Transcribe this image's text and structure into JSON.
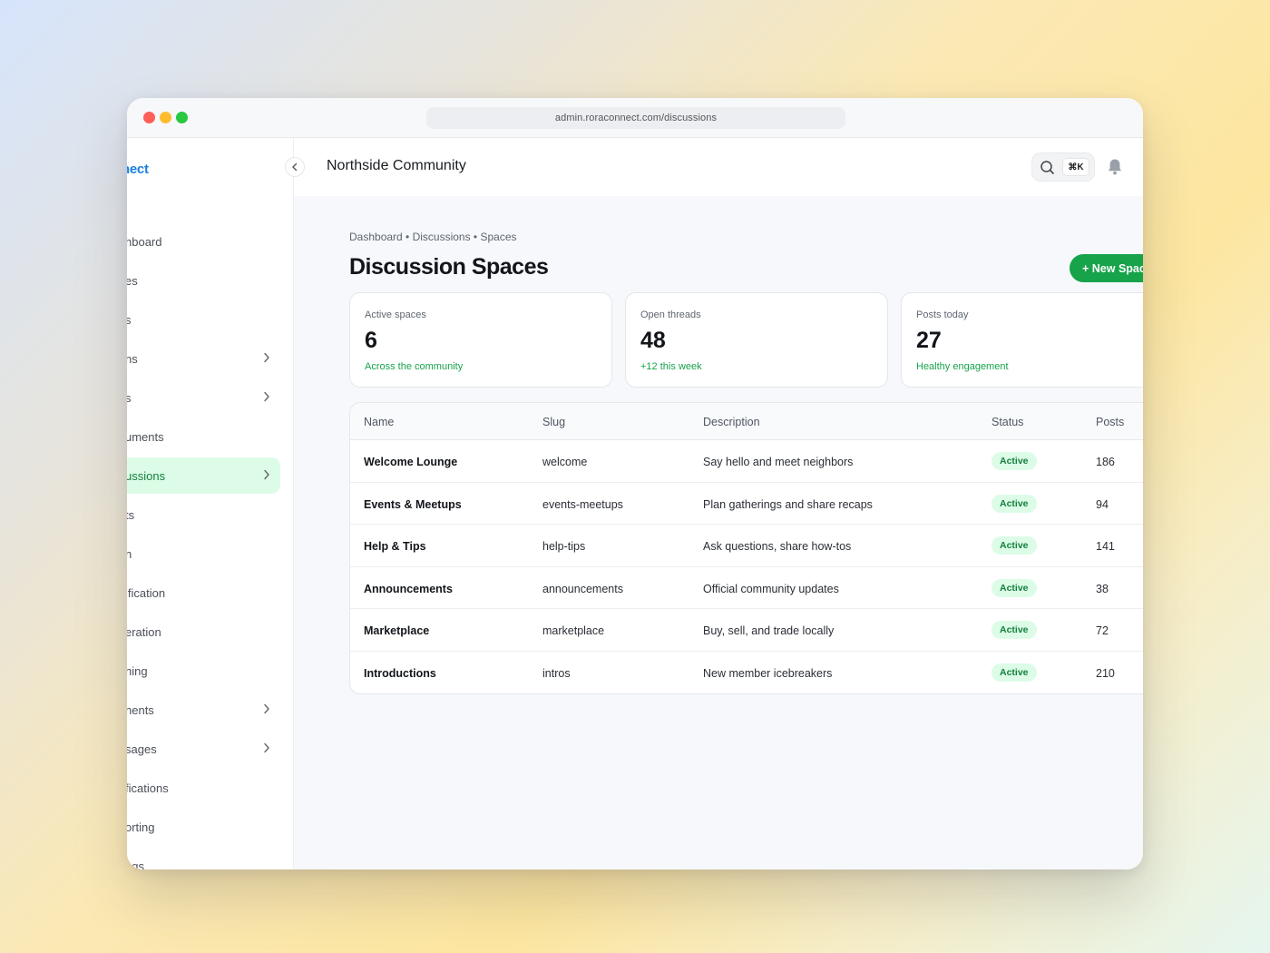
{
  "browser": {
    "url": "admin.roraconnect.com/discussions"
  },
  "sidebar": {
    "brand": "nect",
    "items": [
      {
        "label": "hboard",
        "chevron": false,
        "active": false
      },
      {
        "label": "es",
        "chevron": false,
        "active": false
      },
      {
        "label": "s",
        "chevron": false,
        "active": false
      },
      {
        "label": "ns",
        "chevron": true,
        "active": false
      },
      {
        "label": "s",
        "chevron": true,
        "active": false
      },
      {
        "label": "uments",
        "chevron": false,
        "active": false
      },
      {
        "label": "ussions",
        "chevron": true,
        "active": true
      },
      {
        "label": "ts",
        "chevron": false,
        "active": false
      },
      {
        "label": "n",
        "chevron": false,
        "active": false
      },
      {
        "label": "ification",
        "chevron": false,
        "active": false
      },
      {
        "label": "eration",
        "chevron": false,
        "active": false
      },
      {
        "label": "ning",
        "chevron": false,
        "active": false
      },
      {
        "label": "nents",
        "chevron": true,
        "active": false
      },
      {
        "label": "sages",
        "chevron": true,
        "active": false
      },
      {
        "label": "fications",
        "chevron": false,
        "active": false
      },
      {
        "label": "orting",
        "chevron": false,
        "active": false
      },
      {
        "label": "ngs",
        "chevron": false,
        "active": false
      }
    ]
  },
  "header": {
    "org_title": "Northside Community",
    "search_shortcut": "⌘K"
  },
  "page": {
    "breadcrumb": "Dashboard • Discussions • Spaces",
    "title": "Discussion Spaces",
    "new_button": "+ New Spac"
  },
  "stats": [
    {
      "label": "Active spaces",
      "value": "6",
      "note": "Across the community"
    },
    {
      "label": "Open threads",
      "value": "48",
      "note": "+12 this week"
    },
    {
      "label": "Posts today",
      "value": "27",
      "note": "Healthy engagement"
    }
  ],
  "table": {
    "headers": [
      "Name",
      "Slug",
      "Description",
      "Status",
      "Posts"
    ],
    "rows": [
      {
        "name": "Welcome Lounge",
        "slug": "welcome",
        "description": "Say hello and meet neighbors",
        "status": "Active",
        "posts": "186"
      },
      {
        "name": "Events & Meetups",
        "slug": "events-meetups",
        "description": "Plan gatherings and share recaps",
        "status": "Active",
        "posts": "94"
      },
      {
        "name": "Help & Tips",
        "slug": "help-tips",
        "description": "Ask questions, share how-tos",
        "status": "Active",
        "posts": "141"
      },
      {
        "name": "Announcements",
        "slug": "announcements",
        "description": "Official community updates",
        "status": "Active",
        "posts": "38"
      },
      {
        "name": "Marketplace",
        "slug": "marketplace",
        "description": "Buy, sell, and trade locally",
        "status": "Active",
        "posts": "72"
      },
      {
        "name": "Introductions",
        "slug": "intros",
        "description": "New member icebreakers",
        "status": "Active",
        "posts": "210"
      }
    ]
  },
  "colors": {
    "accent_green": "#16a34a",
    "active_bg": "#dcfce7",
    "brand_blue": "#1a7fe0"
  }
}
